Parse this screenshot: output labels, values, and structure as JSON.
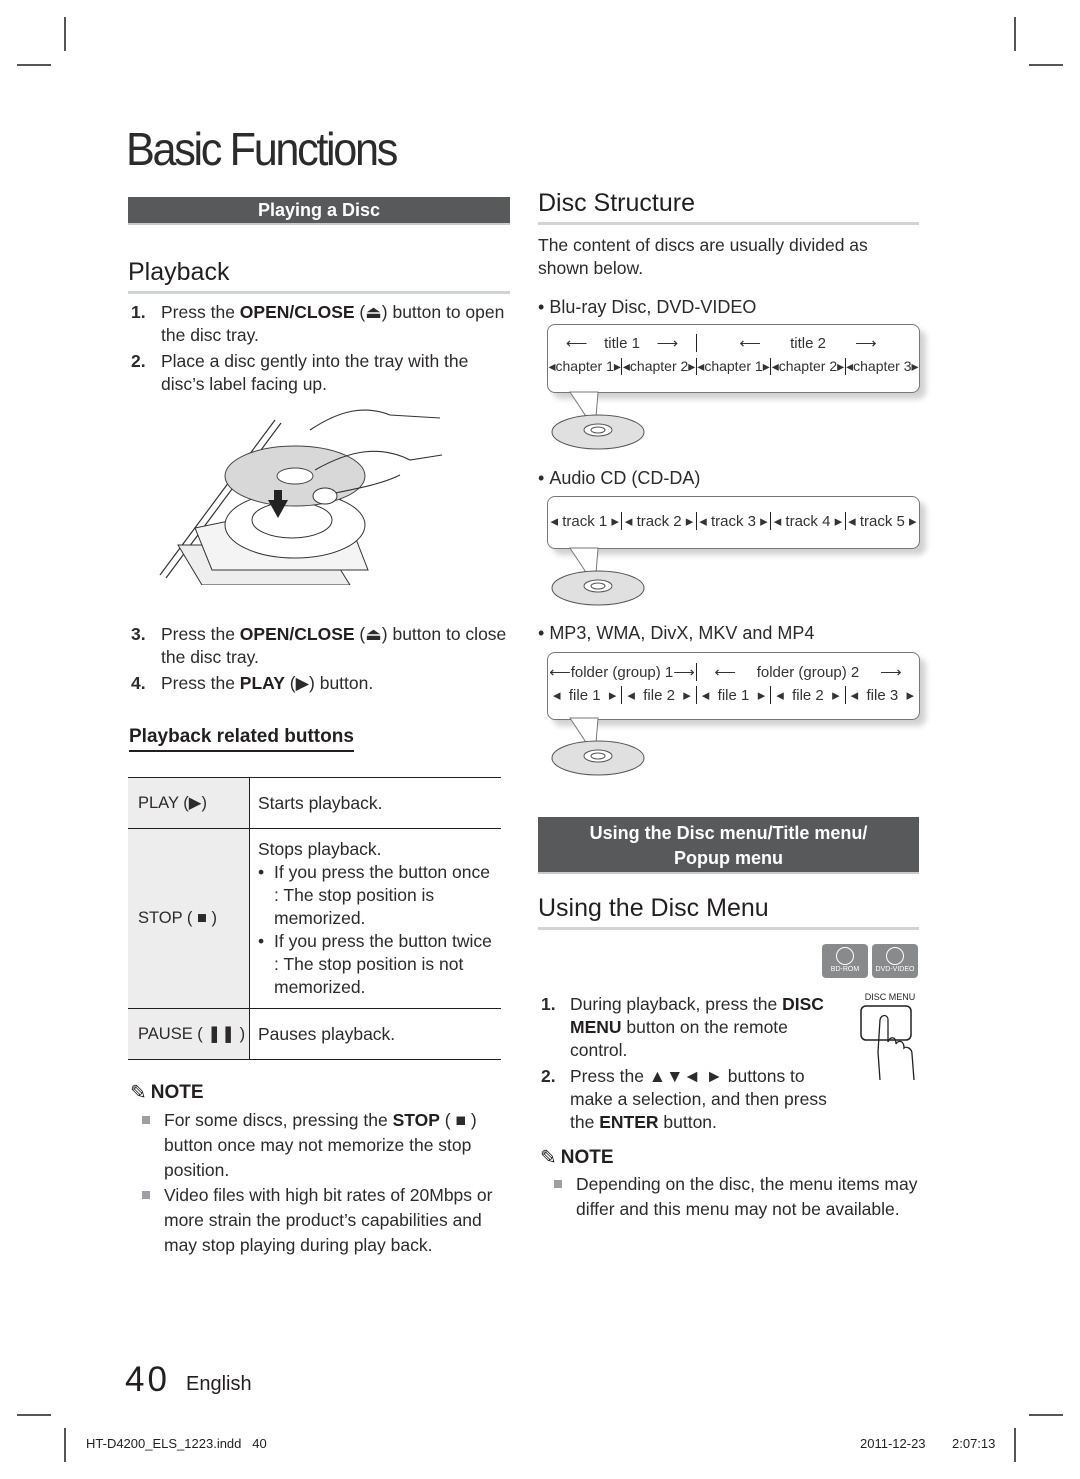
{
  "page": {
    "title": "Basic Functions",
    "page_number": "40",
    "language": "English",
    "footer_file": "HT-D4200_ELS_1223.indd   40",
    "footer_date": "2011-12-23",
    "footer_time": "2:07:13"
  },
  "left": {
    "section_bar": "Playing a Disc",
    "heading": "Playback",
    "steps_a": [
      {
        "num": "1.",
        "pre": "Press the ",
        "bold": "OPEN/CLOSE",
        "post": " (⏏) button to open the disc tray."
      },
      {
        "num": "2.",
        "pre": "Place a disc gently into the tray with the disc’s label facing up.",
        "bold": "",
        "post": ""
      }
    ],
    "steps_b": [
      {
        "num": "3.",
        "pre": "Press the ",
        "bold": "OPEN/CLOSE",
        "post": " (⏏) button to close the disc tray."
      },
      {
        "num": "4.",
        "pre": "Press the ",
        "bold": "PLAY",
        "post": " (▶) button."
      }
    ],
    "subheading": "Playback related buttons",
    "table": [
      {
        "key": "PLAY (▶)",
        "desc": "Starts playback.",
        "bullets": []
      },
      {
        "key": "STOP ( ■ )",
        "desc": "Stops playback.",
        "bullets": [
          "If you press the button once : The stop position is memorized.",
          "If you press the button twice : The stop position is not memorized."
        ]
      },
      {
        "key": "PAUSE ( ❚❚ )",
        "desc": "Pauses playback.",
        "bullets": []
      }
    ],
    "note_label": "NOTE",
    "notes": [
      {
        "pre": "For some discs, pressing the ",
        "bold": "STOP",
        "post": " ( ■ ) button once may not memorize the stop position."
      },
      {
        "pre": "Video files with high bit rates of 20Mbps or more strain the product’s capabilities and may stop playing during play back.",
        "bold": "",
        "post": ""
      }
    ]
  },
  "right": {
    "heading": "Disc Structure",
    "intro": "The content of discs are usually divided as shown below.",
    "bluray": {
      "label": "Blu-ray Disc, DVD-VIDEO",
      "titles": [
        "title 1",
        "title 2"
      ],
      "chapters": [
        "chapter 1",
        "chapter 2",
        "chapter 1",
        "chapter 2",
        "chapter 3"
      ]
    },
    "audiocd": {
      "label": "Audio CD (CD-DA)",
      "tracks": [
        "track 1",
        "track 2",
        "track 3",
        "track 4",
        "track 5"
      ]
    },
    "files": {
      "label": "MP3, WMA, DivX, MKV and MP4",
      "folders": [
        "folder (group) 1",
        "folder (group) 2"
      ],
      "files": [
        "file 1",
        "file 2",
        "file 1",
        "file 2",
        "file 3"
      ]
    },
    "section_bar_line1": "Using the Disc menu/Title menu/",
    "section_bar_line2": "Popup menu",
    "heading2": "Using the Disc Menu",
    "badges": [
      "BD-ROM",
      "DVD-VIDEO"
    ],
    "remote_label": "DISC MENU",
    "steps": [
      {
        "num": "1.",
        "pre": "During playback, press the ",
        "bold": "DISC MENU",
        "post": "  button on the remote control."
      },
      {
        "num": "2.",
        "pre": "Press the ▲▼◄ ► buttons to make a selection, and then press the ",
        "bold": "ENTER",
        "post": " button."
      }
    ],
    "note_label": "NOTE",
    "notes": [
      "Depending on the disc, the menu items may differ and this menu may not be available."
    ]
  }
}
